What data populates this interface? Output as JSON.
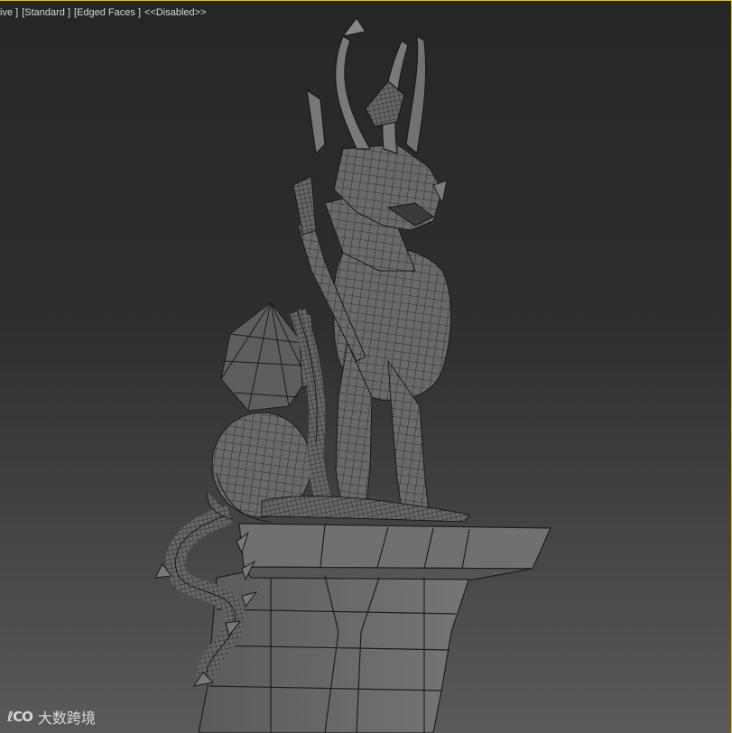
{
  "viewport": {
    "labels": {
      "view": "ive ]",
      "shading": "[Standard ]",
      "mode": "[Edged Faces ]",
      "status": "<<Disabled>>"
    },
    "border_color": "#f0c000"
  },
  "watermark": {
    "logo": "ℓCO",
    "text": "大数跨境"
  },
  "colors": {
    "background_top": "#262626",
    "background_bottom": "#5a5a5a",
    "mesh_fill": "#6e6e6e",
    "wire": "#1a1a1a"
  }
}
